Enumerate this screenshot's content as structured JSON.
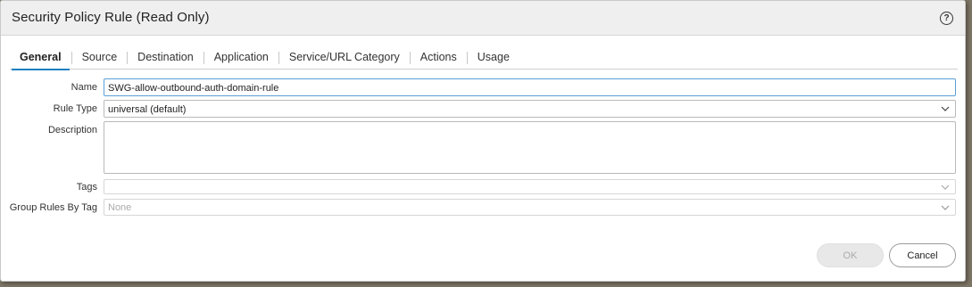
{
  "dialog": {
    "title": "Security Policy Rule (Read Only)",
    "help_glyph": "?"
  },
  "tabs": [
    {
      "label": "General",
      "active": true
    },
    {
      "label": "Source"
    },
    {
      "label": "Destination"
    },
    {
      "label": "Application"
    },
    {
      "label": "Service/URL Category"
    },
    {
      "label": "Actions"
    },
    {
      "label": "Usage"
    }
  ],
  "form": {
    "name": {
      "label": "Name",
      "value": "SWG-allow-outbound-auth-domain-rule"
    },
    "rule_type": {
      "label": "Rule Type",
      "value": "universal (default)"
    },
    "description": {
      "label": "Description",
      "value": ""
    },
    "tags": {
      "label": "Tags",
      "value": ""
    },
    "group_rules_by_tag": {
      "label": "Group Rules By Tag",
      "value": "None"
    }
  },
  "buttons": {
    "ok": "OK",
    "cancel": "Cancel"
  },
  "colors": {
    "accent": "#1b7fc1",
    "titlebar": "#efefef"
  }
}
